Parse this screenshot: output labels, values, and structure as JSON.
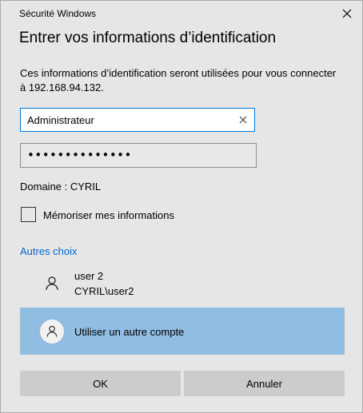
{
  "window": {
    "title": "Sécurité Windows",
    "close_icon": "close-icon"
  },
  "dialog": {
    "heading": "Entrer vos informations d’identification",
    "description": "Ces informations d’identification seront utilisées pour vous connecter à 192.168.94.132."
  },
  "username_field": {
    "value": "Administrateur",
    "clear_icon": "clear-x-icon"
  },
  "password_field": {
    "masked_value": "••••••••••••••"
  },
  "domain": {
    "text": "Domaine : CYRIL"
  },
  "remember": {
    "label": "Mémoriser mes informations",
    "checked": false
  },
  "more_choices": {
    "label": "Autres choix"
  },
  "accounts": [
    {
      "name": "user 2",
      "sub": "CYRIL\\user2",
      "icon": "user-icon"
    },
    {
      "name": "Utiliser un autre compte",
      "icon": "user-icon",
      "selected": true
    }
  ],
  "buttons": {
    "ok_label": "OK",
    "cancel_label": "Annuler"
  },
  "colors": {
    "background": "#e6e6e6",
    "accent": "#0078d7",
    "link": "#0066cc",
    "selected_row": "#91bde3",
    "button": "#cccccc"
  }
}
